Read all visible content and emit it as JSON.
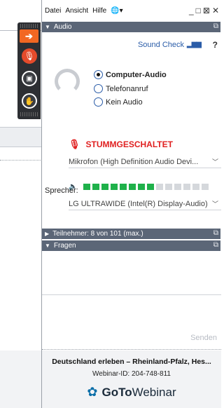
{
  "menu": {
    "datei": "Datei",
    "ansicht": "Ansicht",
    "hilfe": "Hilfe"
  },
  "window_controls": {
    "minimize": "_",
    "restore": "□",
    "close_box": "⊠",
    "close": "✕"
  },
  "audio": {
    "header": "Audio",
    "sound_check": "Sound Check",
    "help": "?",
    "options": [
      "Computer-Audio",
      "Telefonanruf",
      "Kein Audio"
    ],
    "selected": "Computer-Audio",
    "muted_label": "STUMMGESCHALTET",
    "microphone": "Mikrofon (High Definition Audio Devi...",
    "mic_level": 0.5,
    "speaker": "LG ULTRAWIDE (Intel(R) Display-Audio)",
    "speaker_label": "Sprecher:"
  },
  "attendees": {
    "header": "Teilnehmer: 8 von 101 (max.)"
  },
  "questions": {
    "header": "Fragen",
    "send": "Senden"
  },
  "footer": {
    "title": "Deutschland erleben – Rheinland-Pfalz, Hes...",
    "webinar_id": "Webinar-ID: 204-748-811",
    "logo_goto": "GoTo",
    "logo_webinar": "Webinar"
  },
  "colors": {
    "accent": "#f26722",
    "header_bg": "#5b6677",
    "muted": "#e02020",
    "level": "#1fb14a",
    "link": "#2a5ca8"
  }
}
